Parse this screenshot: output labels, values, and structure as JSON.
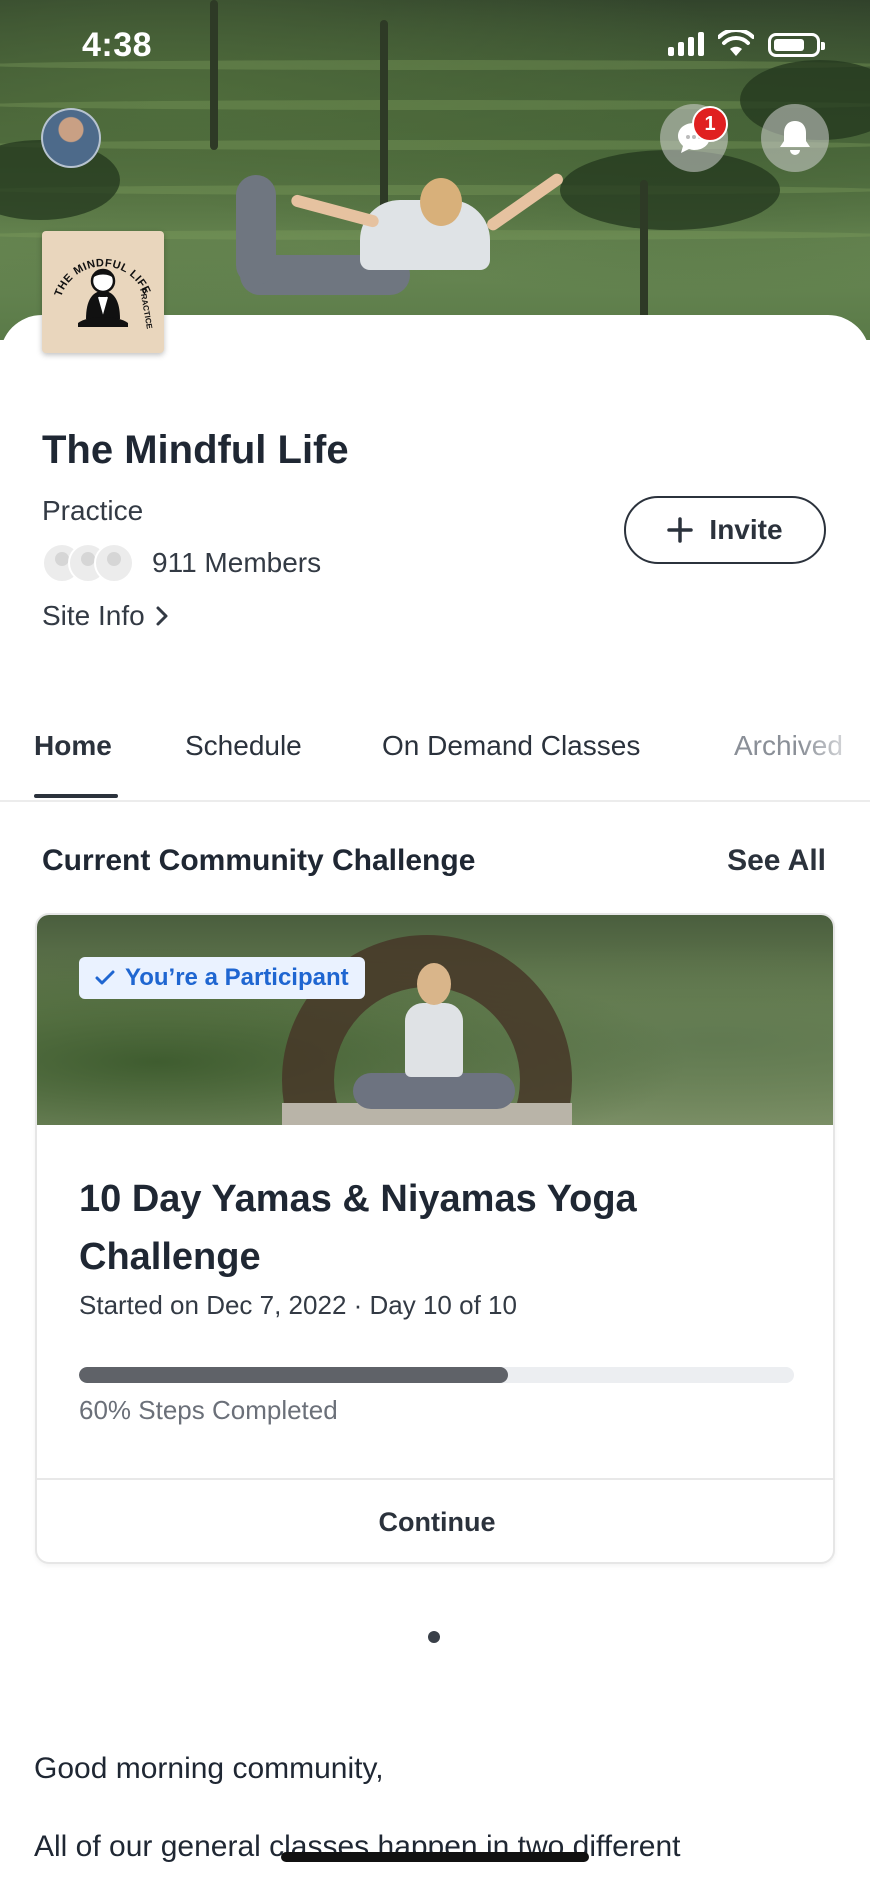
{
  "status_bar": {
    "time": "4:38"
  },
  "header": {
    "notification_count": "1",
    "logo_text_top": "THE MINDFUL LIFE",
    "logo_text_side": "PRACTICE"
  },
  "site": {
    "title": "The Mindful Life",
    "subtitle": "Practice",
    "members": "911 Members",
    "site_info": "Site Info",
    "invite_label": "Invite"
  },
  "tabs": [
    {
      "label": "Home"
    },
    {
      "label": "Schedule"
    },
    {
      "label": "On Demand Classes"
    },
    {
      "label": "Archived"
    }
  ],
  "challenge_section": {
    "title": "Current Community Challenge",
    "see_all": "See All"
  },
  "challenge": {
    "participant_badge": "You’re a Participant",
    "title": "10 Day Yamas & Niyamas Yoga Challenge",
    "meta": "Started on Dec 7, 2022 · Day 10 of 10",
    "progress_label": "60% Steps Completed",
    "progress_fraction": 0.6,
    "continue_label": "Continue"
  },
  "post": {
    "greeting": "Good morning community,",
    "body": "All of our general classes happen in two different"
  },
  "colors": {
    "accent_blue": "#1f66d1",
    "badge_red": "#e02020",
    "text_dark": "#1f2733"
  }
}
